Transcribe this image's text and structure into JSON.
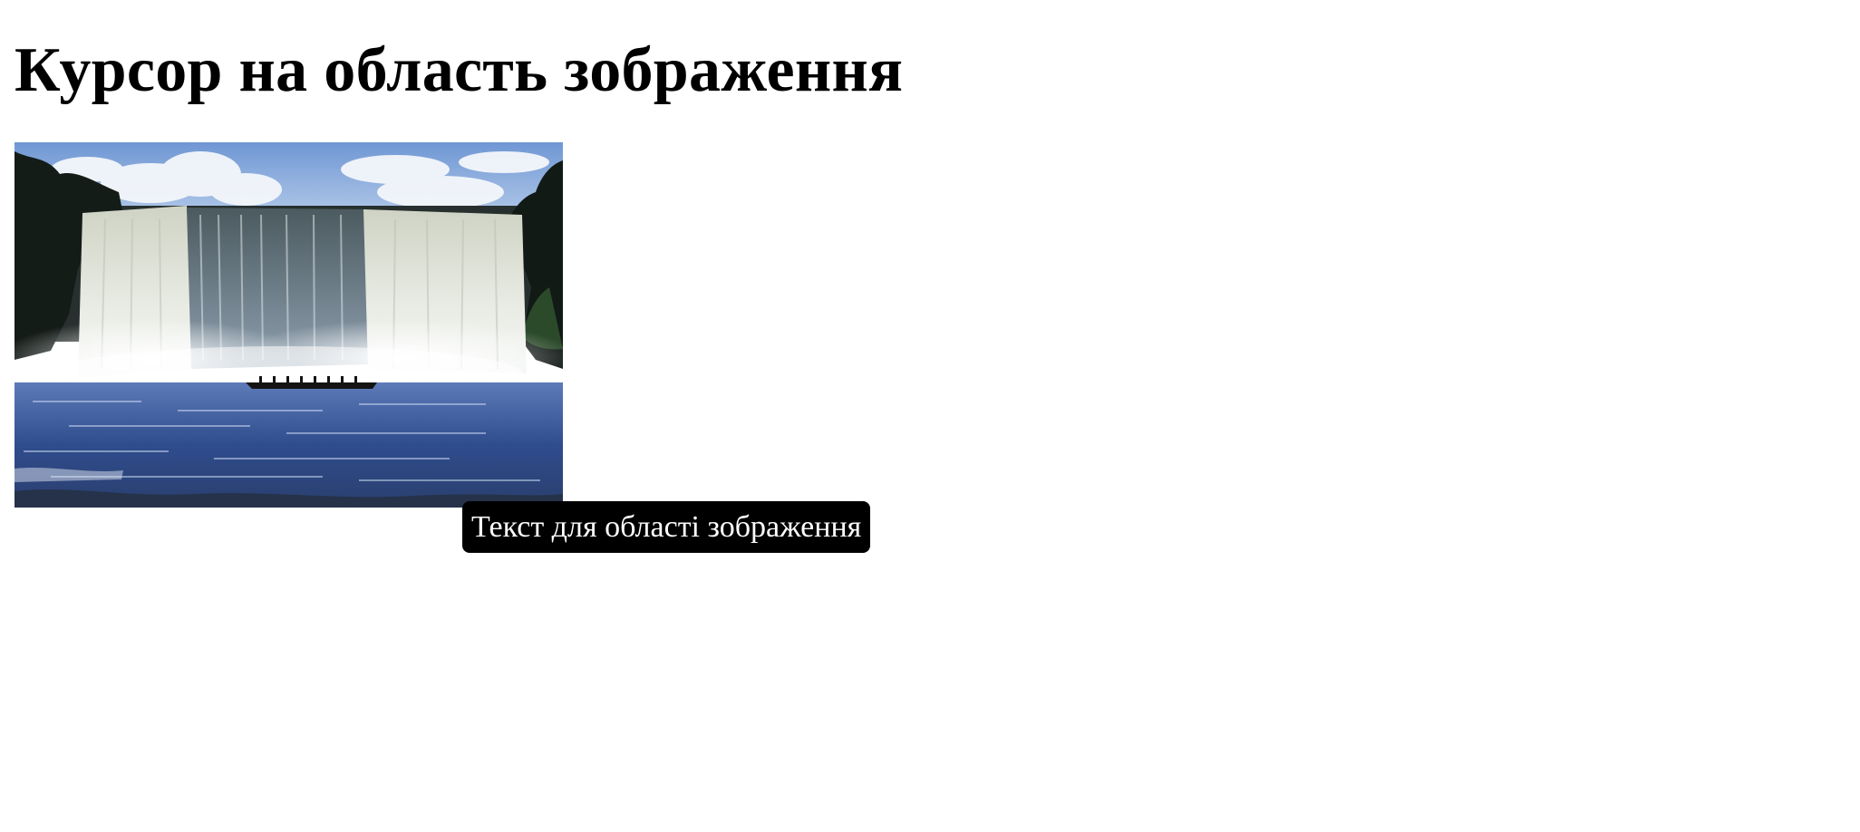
{
  "page": {
    "title": "Курсор на область зображення"
  },
  "image_area": {
    "picture": "waterfall-photo",
    "tooltip_text": "Текст для області зображення",
    "colors": {
      "sky": "#8fb2e0",
      "water": "#3c5a9c",
      "foliage": "#15201a",
      "falls": "#e8ece6",
      "tooltip_bg": "#000000",
      "tooltip_text": "#ffffff"
    }
  }
}
